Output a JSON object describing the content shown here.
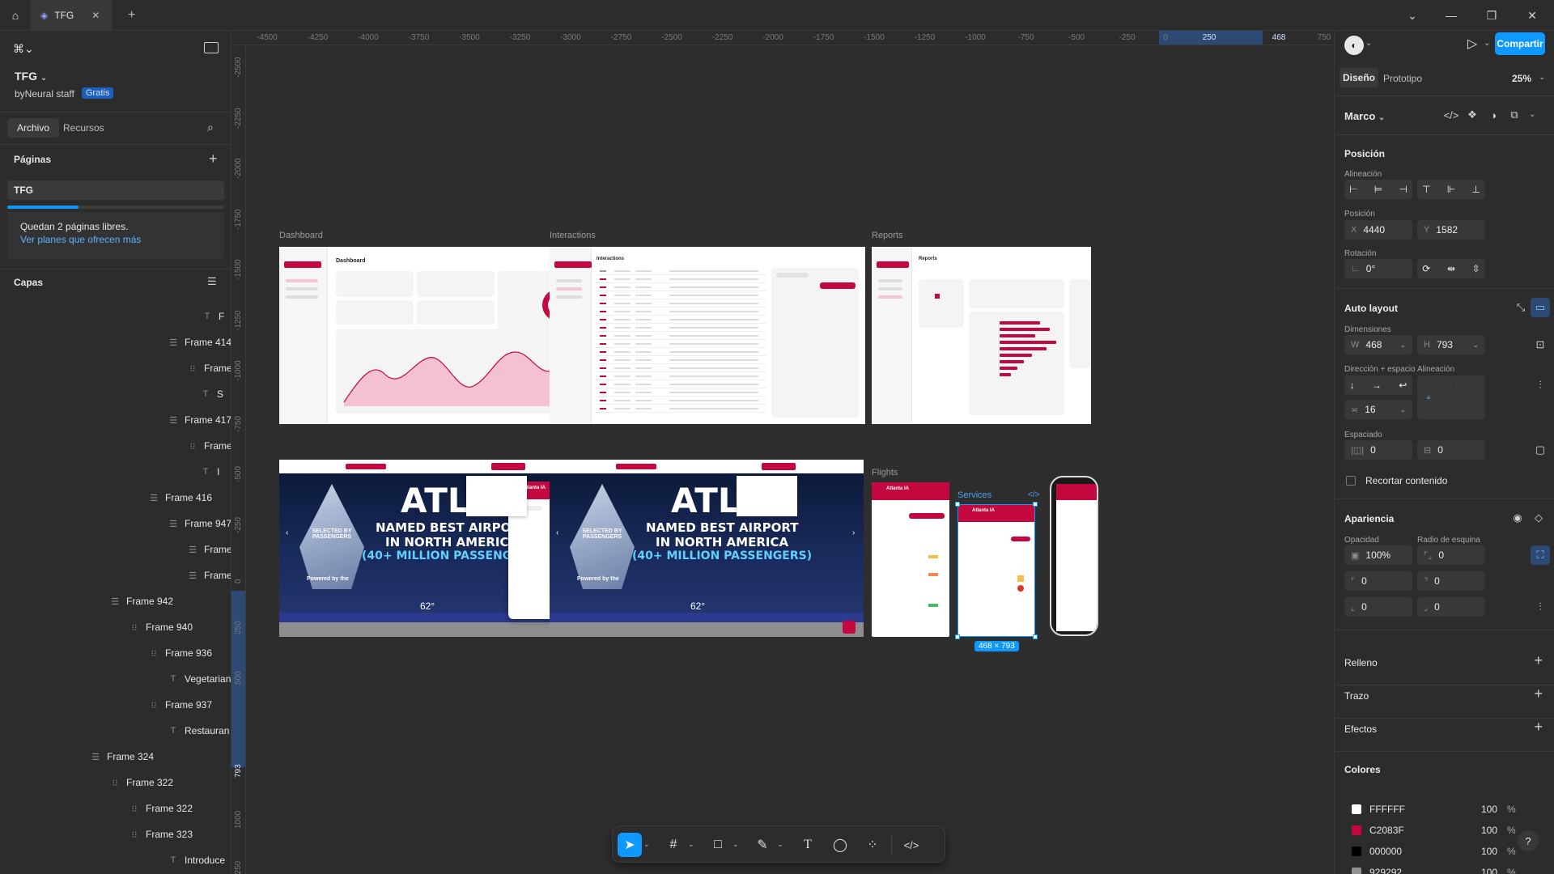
{
  "topbar": {
    "home_icon": "home-icon",
    "tab_title": "TFG",
    "colors": {
      "bg": "#2c2c2c",
      "active_tab": "#383838"
    }
  },
  "left": {
    "project_name": "TFG",
    "team": "byNeural staff",
    "plan_badge": "Gratis",
    "tabs": [
      "Archivo",
      "Recursos"
    ],
    "pages_title": "Páginas",
    "pages": [
      "TFG"
    ],
    "notice": "Quedan 2 páginas libres.",
    "notice_link": "Ver planes que ofrecen más",
    "layers_title": "Capas",
    "layers": [
      {
        "icon": "T",
        "label": "F"
      },
      {
        "icon": "☰",
        "label": "Frame 414"
      },
      {
        "icon": "⁝⁝",
        "label": "Frame"
      },
      {
        "icon": "T",
        "label": "S"
      },
      {
        "icon": "☰",
        "label": "Frame 417"
      },
      {
        "icon": "⁝⁝",
        "label": "Frame"
      },
      {
        "icon": "T",
        "label": "I"
      },
      {
        "icon": "☰",
        "label": "Frame 416"
      },
      {
        "icon": "☰",
        "label": "Frame 947"
      },
      {
        "icon": "☰",
        "label": "Frame"
      },
      {
        "icon": "☰",
        "label": "Frame"
      },
      {
        "icon": "☰",
        "label": "Frame 942"
      },
      {
        "icon": "⁝⁝",
        "label": "Frame 940"
      },
      {
        "icon": "⁝⁝",
        "label": "Frame 936"
      },
      {
        "icon": "T",
        "label": "Vegetarian"
      },
      {
        "icon": "⁝⁝",
        "label": "Frame 937"
      },
      {
        "icon": "T",
        "label": "Restauran"
      },
      {
        "icon": "☰",
        "label": "Frame 324"
      },
      {
        "icon": "⁝⁝",
        "label": "Frame 322"
      },
      {
        "icon": "⁝⁝",
        "label": "Frame 322"
      },
      {
        "icon": "⁝⁝",
        "label": "Frame 323"
      },
      {
        "icon": "T",
        "label": "Introduce"
      }
    ]
  },
  "ruler": {
    "h": [
      "-4500",
      "-4250",
      "-4000",
      "-3750",
      "-3500",
      "-3250",
      "-3000",
      "-2750",
      "-2500",
      "-2250",
      "-2000",
      "-1750",
      "-1500",
      "-1250",
      "-1000",
      "-750",
      "-500",
      "-250",
      "0",
      "250",
      "468",
      "750"
    ],
    "v": [
      "-2500",
      "-2250",
      "-2000",
      "-1750",
      "-1500",
      "-1250",
      "-1000",
      "-750",
      "-500",
      "-250",
      "0",
      "250",
      "500",
      "793",
      "1000",
      "1250"
    ]
  },
  "canvas": {
    "frames": {
      "dashboard": "Dashboard",
      "interactions": "Interactions",
      "reports": "Reports",
      "flights": "Flights",
      "services": "Services"
    },
    "dashboard_title": "Dashboard",
    "interactions_title": "Interactions",
    "reports_title": "Reports",
    "hero_line1": "NAMED BEST AIRPORT",
    "hero_line2": "IN NORTH AMERICA",
    "hero_line3a": "(40+ MILLION PASSENGE",
    "hero_line3b": "(40+ MILLION PASSENGERS)",
    "hero_atl": "ATL",
    "trophy_text": "SELECTED BY PASSENGERS",
    "powered": "Powered by the",
    "temp": "62°",
    "chat_title": "Atlanta IA",
    "selection_size": "468 × 793",
    "accent": "#c2083f"
  },
  "right": {
    "share_label": "Compartir",
    "tabs": [
      "Diseño",
      "Prototipo"
    ],
    "zoom": "25%",
    "frame_label": "Marco",
    "position_title": "Posición",
    "alignment_label": "Alineación",
    "position_label": "Posición",
    "x_label": "X",
    "x_value": "4440",
    "y_label": "Y",
    "y_value": "1582",
    "rotation_label": "Rotación",
    "rotation_value": "0°",
    "autolayout_title": "Auto layout",
    "dimensions_label": "Dimensiones",
    "w_label": "W",
    "w_value": "468",
    "h_label": "H",
    "h_value": "793",
    "direction_label": "Dirección + espacio",
    "align_label": "Alineación",
    "gap_value": "16",
    "spacing_label": "Espaciado",
    "pad_h": "0",
    "pad_v": "0",
    "clip_label": "Recortar contenido",
    "appearance_title": "Apariencia",
    "opacity_label": "Opacidad",
    "opacity_value": "100%",
    "radius_label": "Radio de esquina",
    "radius_value": "0",
    "radius_tl": "0",
    "radius_tr": "0",
    "radius_bl": "0",
    "radius_br": "0",
    "fill_title": "Relleno",
    "stroke_title": "Trazo",
    "effects_title": "Efectos",
    "colors_title": "Colores",
    "colors": [
      {
        "hex": "FFFFFF",
        "swatch": "#ffffff",
        "opacity": "100",
        "pct": "%"
      },
      {
        "hex": "C2083F",
        "swatch": "#c2083f",
        "opacity": "100",
        "pct": "%"
      },
      {
        "hex": "000000",
        "swatch": "#000000",
        "opacity": "100",
        "pct": "%"
      },
      {
        "hex": "929292",
        "swatch": "#929292",
        "opacity": "100",
        "pct": "%"
      }
    ]
  },
  "toolbar": {
    "tools": [
      "move-tool",
      "frame-tool",
      "shape-tool",
      "pen-tool",
      "text-tool",
      "comment-tool",
      "components-tool",
      "dev-mode-tool"
    ]
  }
}
